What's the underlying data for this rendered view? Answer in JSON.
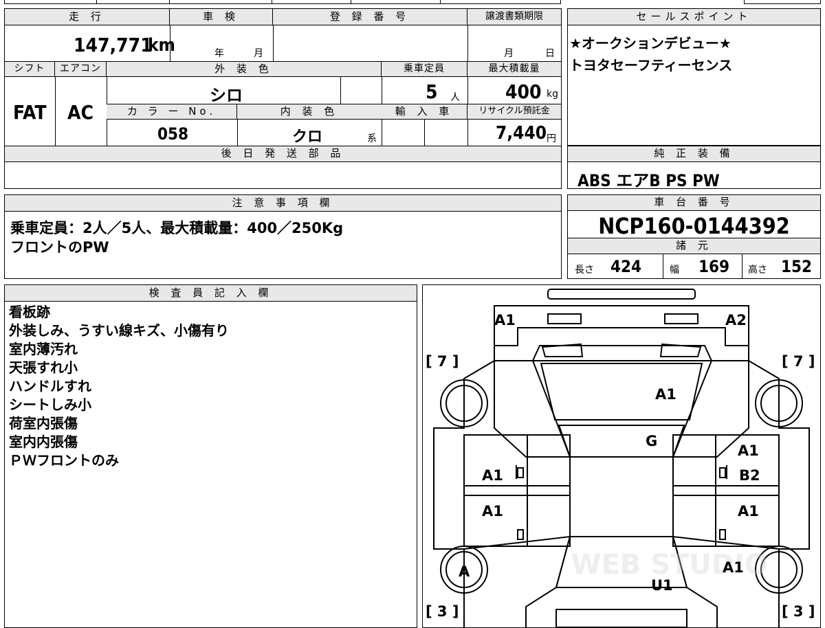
{
  "spec": {
    "mileage_header": "走 行",
    "mileage_value": "147,771",
    "mileage_unit": "km",
    "shaken_header": "車 検",
    "shaken_year": "年",
    "shaken_month": "月",
    "reg_header": "登 録 番 号",
    "transfer_header": "譲渡書類期限",
    "transfer_month": "月",
    "transfer_day": "日",
    "shift_header": "シフト",
    "shift_value": "FAT",
    "aircon_header": "エアコン",
    "aircon_value": "AC",
    "ext_color_header": "外 装 色",
    "ext_color_value": "シロ",
    "capacity_header": "乗車定員",
    "capacity_value": "5",
    "capacity_unit": "人",
    "maxload_header": "最大積載量",
    "maxload_value": "400",
    "maxload_unit": "kg",
    "color_no_header": "カ ラ ー No.",
    "color_no_value": "058",
    "int_color_header": "内 装 色",
    "int_color_value": "クロ",
    "int_color_suffix": "系",
    "import_header": "輸 入 車",
    "recycle_header": "リサイクル預託金",
    "recycle_value": "7,440",
    "recycle_unit": "円",
    "later_parts_header": "後 日 発 送 部 品"
  },
  "sales": {
    "header": "セールスポイント",
    "lines": [
      "★オークションデビュー★",
      "トヨタセーフティーセンス"
    ]
  },
  "equipment": {
    "header": "純 正 装 備",
    "value": "ABS エアB PS PW"
  },
  "notes": {
    "header": "注 意 事 項 欄",
    "lines": [
      "乗車定員：2人／5人、最大積載量：400／250Kg",
      "フロントのPW"
    ]
  },
  "chassis": {
    "header": "車 台 番 号",
    "value": "NCP160-0144392"
  },
  "dimensions": {
    "header": "諸 元",
    "length_label": "長さ",
    "length_value": "424",
    "width_label": "幅",
    "width_value": "169",
    "height_label": "高さ",
    "height_value": "152"
  },
  "inspector": {
    "header": "検 査 員 記 入 欄",
    "lines": [
      "看板跡",
      "外装しみ、うすい線キズ、小傷有り",
      "室内薄汚れ",
      "天張すれ小",
      "ハンドルすれ",
      "シートしみ小",
      "荷室内張傷",
      "室内内張傷",
      "ＰＷフロントのみ"
    ]
  },
  "diagram": {
    "tread_front_left": "[ 7 ]",
    "tread_front_right": "[ 7 ]",
    "tread_rear_left": "[ 3 ]",
    "tread_rear_right": "[ 3 ]",
    "bumper_front_left": "A1",
    "bumper_front_right": "A2",
    "hood": "A1",
    "windshield": "G",
    "front_left_door": "A1",
    "front_right_door_top": "A1",
    "front_right_door": "B2",
    "rear_left_door": "A1",
    "rear_right_door": "A1",
    "left_rear_wheel": "A",
    "right_rear_quarter": "A1",
    "roof_rear": "U1",
    "watermark": "WEB STUDIO"
  }
}
